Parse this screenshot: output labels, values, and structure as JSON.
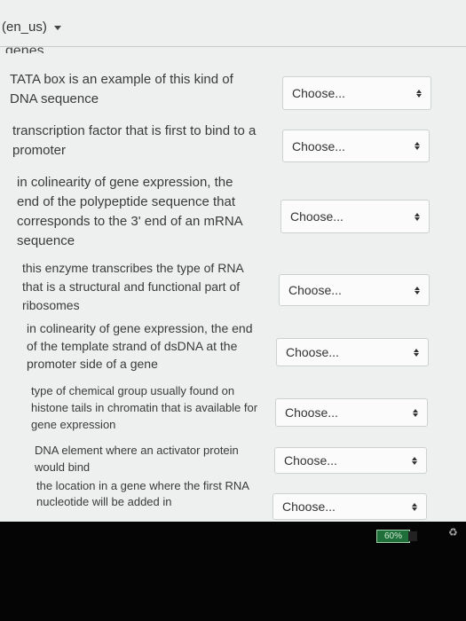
{
  "header": {
    "language": "(en_us)"
  },
  "partial_text": "genes",
  "select_placeholder": "Choose...",
  "questions": [
    "TATA box is an example of this kind of DNA sequence",
    "transcription factor that is first to bind to a promoter",
    "in colinearity of gene expression, the end of the polypeptide sequence that corresponds to the 3' end of an mRNA sequence",
    "this enzyme transcribes the type of RNA that is a structural and functional part of ribosomes",
    "in colinearity of gene expression, the end of the template strand of dsDNA at the promoter side of a gene",
    "type of chemical group usually found on histone tails in chromatin that is available for gene expression",
    "DNA element where an activator protein would bind",
    "the location in a gene where the first RNA nucleotide will be added in"
  ],
  "status": {
    "zoom": "60%"
  },
  "icons": {
    "language_caret": "caret-down-icon",
    "select_arrows": "up-down-arrows-icon",
    "share": "share-icon"
  }
}
